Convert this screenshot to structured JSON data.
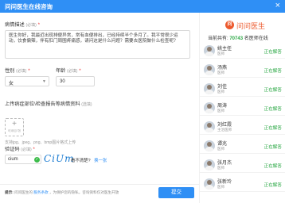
{
  "dialog": {
    "title": "问问医生在线咨询",
    "close_icon": "close-icon"
  },
  "form": {
    "description_label": "病情描述",
    "description_req": "(必填)",
    "description_value": "医生你好，我最近出现排便异常，常有血便排出，已经持续半个多月了。我平常很少运动，饮食偏辣，伴有肛门周围疼痛感，请问这是什么问题？需要去医院做什么检查呢？",
    "sex_label": "性别",
    "sex_req": "(必填)",
    "sex_value": "女",
    "age_label": "年龄",
    "age_req": "(必填)",
    "age_value": "30",
    "upload_label": "上传病症部位\\检查报告等病情资料",
    "upload_req": "(选填)",
    "upload_plus": "+",
    "upload_button_text": "可添加7张",
    "upload_hint": "支持jpg、jpeg、png、bmp图片格式上传",
    "captcha_label": "验证码",
    "captcha_req": "(必填)",
    "captcha_value": "cium",
    "captcha_image_text": "CiUm",
    "captcha_question": "看不清楚?",
    "captcha_refresh": "换一张",
    "footer_prefix": "提示:",
    "footer_text": "问问医生的",
    "footer_link": "服务条款",
    "footer_suffix": "，为保护您的隐私，咨询资料仅对医生开放",
    "submit_label": "提交"
  },
  "sidebar": {
    "brand_logo": "问",
    "brand_name": "问问医生",
    "online_prefix": "当前共有:",
    "online_count": "70743",
    "online_suffix": "名医师在线",
    "doctors": [
      {
        "name": "姚主任",
        "title": "医师",
        "status": "正在解答"
      },
      {
        "name": "汤燕",
        "title": "医师",
        "status": "正在解答"
      },
      {
        "name": "刘佳",
        "title": "医师",
        "status": "正在解答"
      },
      {
        "name": "周涛",
        "title": "医师",
        "status": "正在解答"
      },
      {
        "name": "刘红霞",
        "title": "主治医师",
        "status": "正在解答"
      },
      {
        "name": "谭兆",
        "title": "医师",
        "status": "正在解答"
      },
      {
        "name": "张月杰",
        "title": "医师",
        "status": "正在解答"
      },
      {
        "name": "张新玲",
        "title": "医师",
        "status": "正在解答"
      }
    ]
  },
  "colors": {
    "accent": "#2f8ff5",
    "brand": "#ec5a2e",
    "online": "#2aa744"
  }
}
